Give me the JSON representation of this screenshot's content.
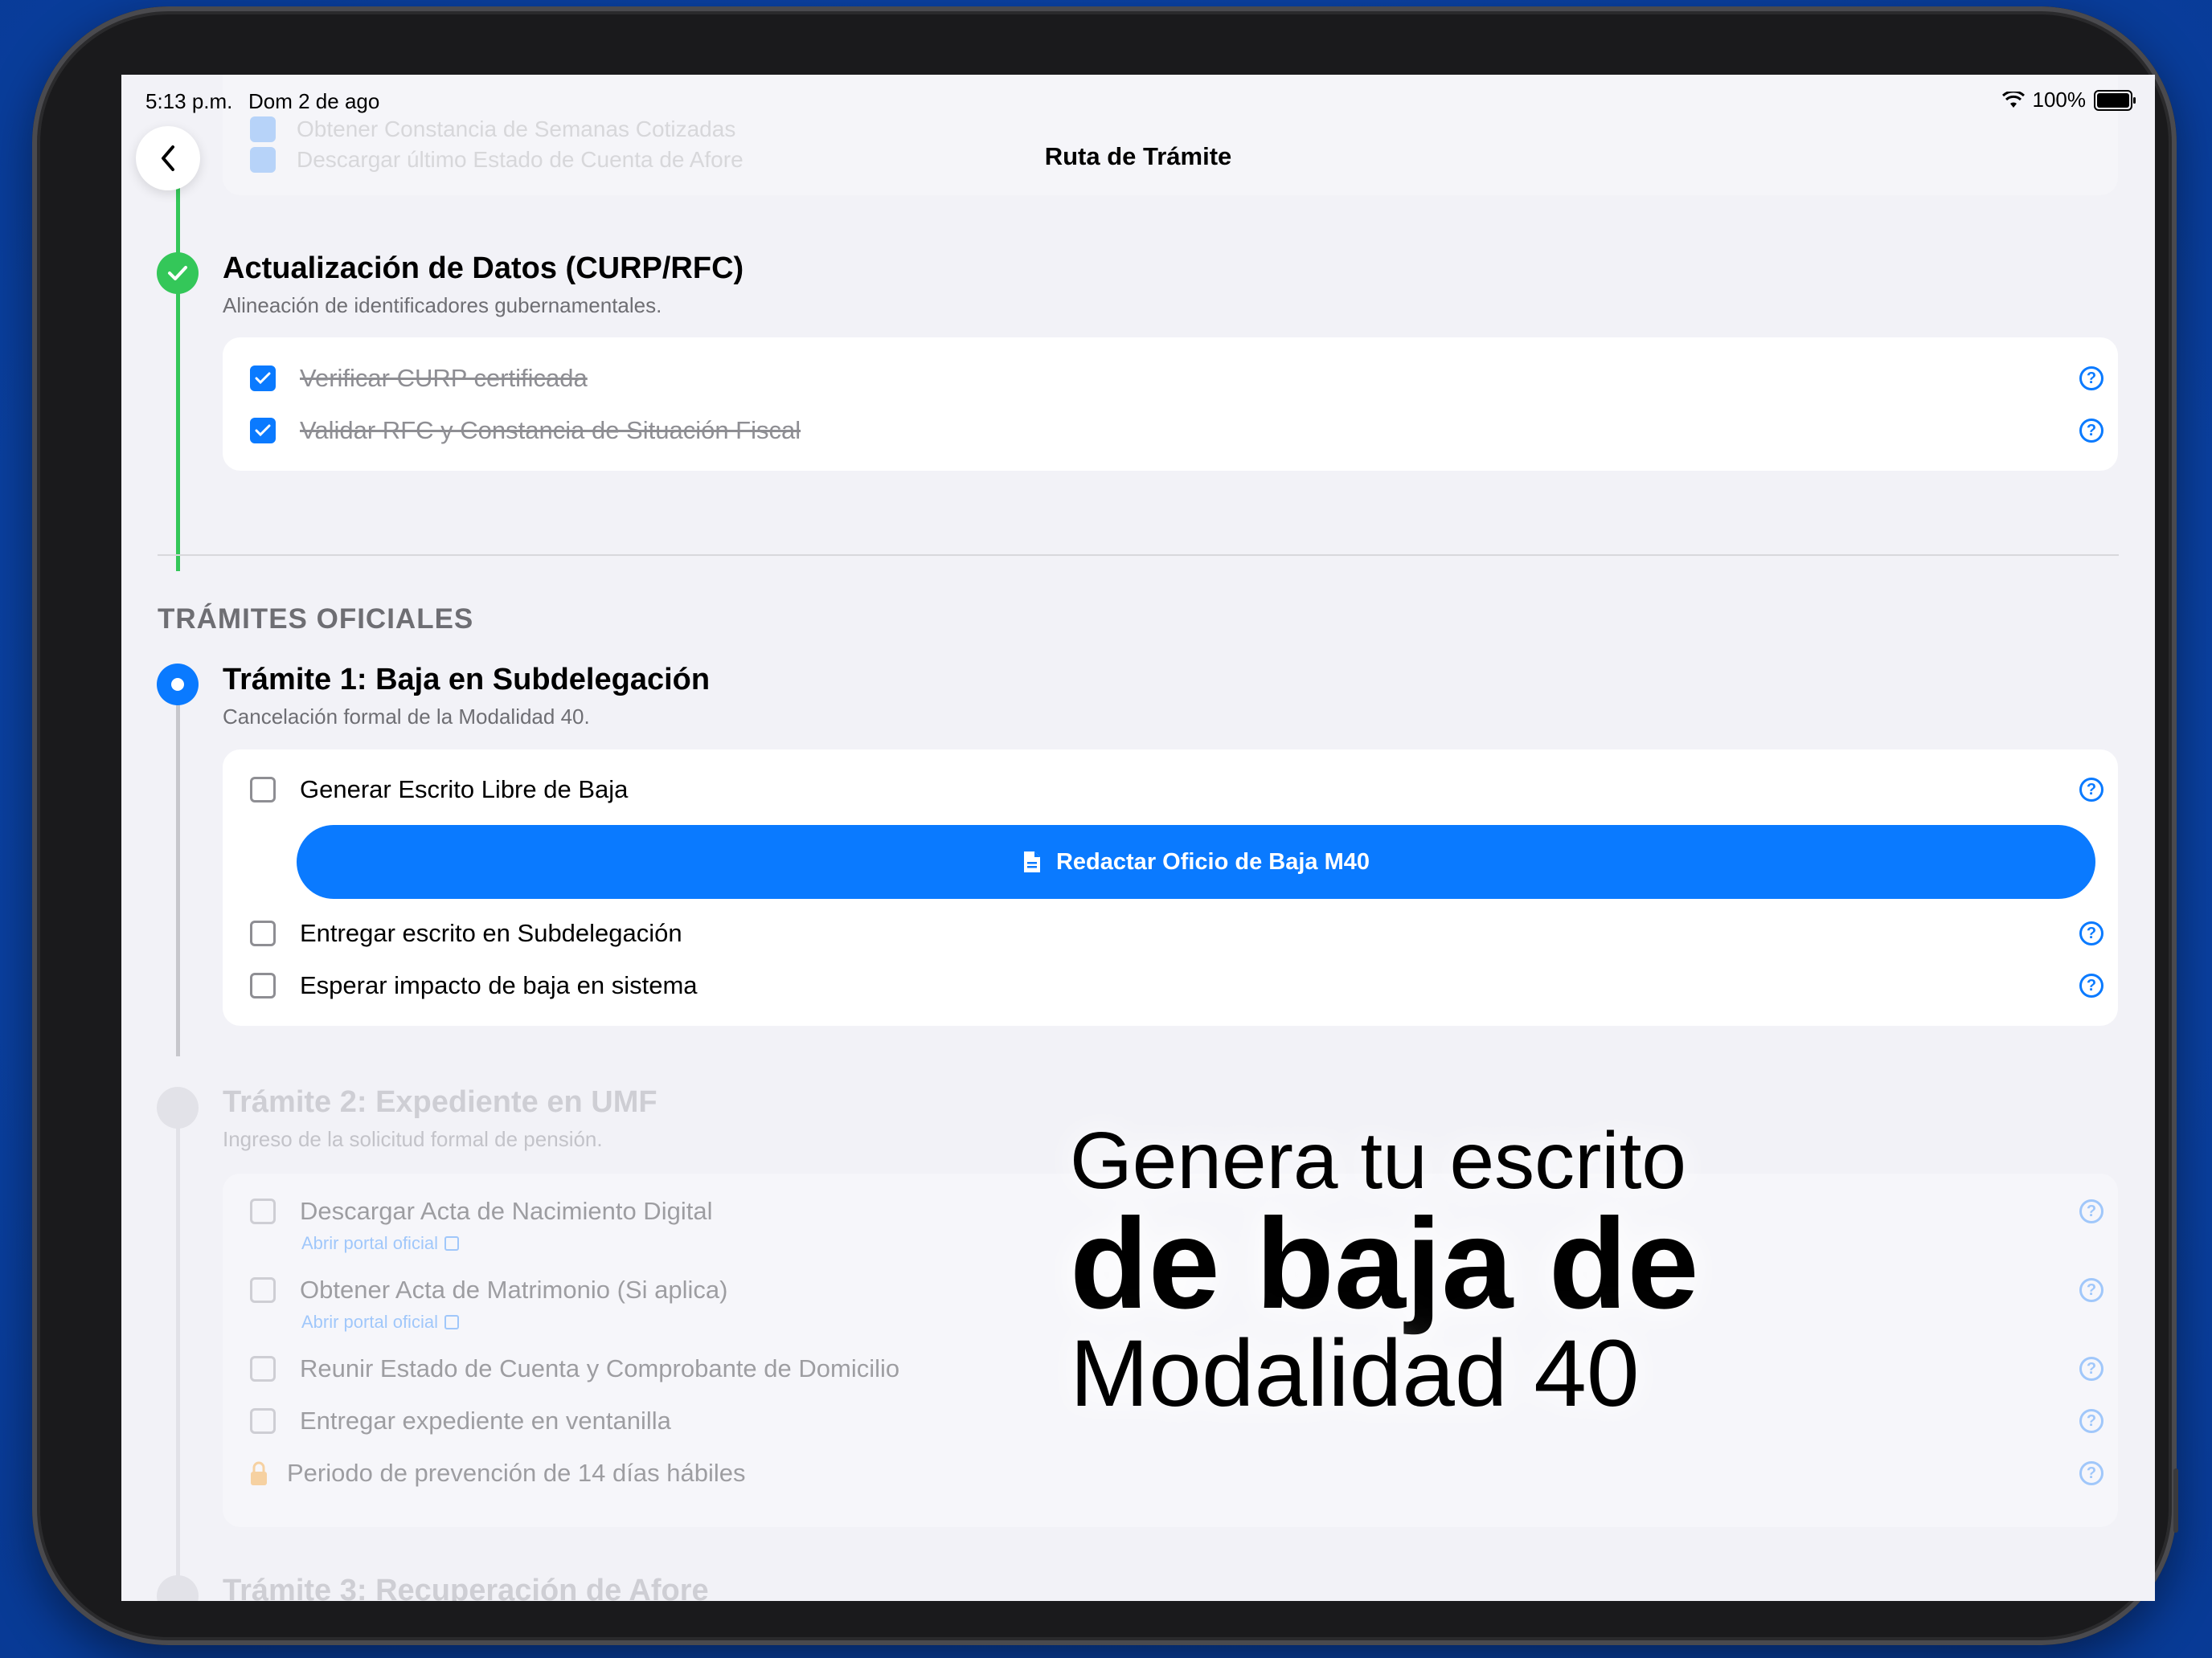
{
  "status_bar": {
    "time": "5:13 p.m.",
    "date": "Dom 2 de ago",
    "battery": "100%"
  },
  "nav": {
    "title": "Ruta de Trámite"
  },
  "top_card": {
    "items": [
      {
        "label": "Obtener Constancia de Semanas Cotizadas",
        "checked": true
      },
      {
        "label": "Descargar último Estado de Cuenta de Afore",
        "checked": true
      }
    ]
  },
  "step_datos": {
    "title": "Actualización de Datos (CURP/RFC)",
    "subtitle": "Alineación de identificadores gubernamentales.",
    "items": [
      {
        "label": "Verificar CURP certificada",
        "checked": true
      },
      {
        "label": "Validar RFC y Constancia de Situación Fiscal",
        "checked": true
      }
    ]
  },
  "section_oficiales": {
    "header": "TRÁMITES OFICIALES"
  },
  "tramite1": {
    "title": "Trámite 1: Baja en Subdelegación",
    "subtitle": "Cancelación formal de la Modalidad 40.",
    "items": [
      {
        "label": "Generar Escrito Libre de Baja",
        "checked": false
      },
      {
        "label": "Entregar escrito en Subdelegación",
        "checked": false
      },
      {
        "label": "Esperar impacto de baja en sistema",
        "checked": false
      }
    ],
    "action_button": "Redactar Oficio de Baja M40"
  },
  "tramite2": {
    "title": "Trámite 2: Expediente en UMF",
    "subtitle": "Ingreso de la solicitud formal de pensión.",
    "items": [
      {
        "label": "Descargar Acta de Nacimiento Digital",
        "link": "Abrir portal oficial"
      },
      {
        "label": "Obtener Acta de Matrimonio (Si aplica)",
        "link": "Abrir portal oficial"
      },
      {
        "label": "Reunir Estado de Cuenta y Comprobante de Domicilio"
      },
      {
        "label": "Entregar expediente en ventanilla"
      },
      {
        "label": "Periodo de prevención de 14 días hábiles",
        "locked": true
      }
    ]
  },
  "tramite3": {
    "title": "Trámite 3: Recuperación de Afore"
  },
  "promo": {
    "line1": "Genera tu escrito",
    "line2": "de baja de",
    "line3": "Modalidad 40"
  },
  "icons": {
    "help": "question-circle-icon",
    "back": "chevron-left-icon",
    "check": "checkmark-icon",
    "doc": "document-icon",
    "lock": "lock-icon",
    "external": "external-link-icon"
  },
  "colors": {
    "accent": "#0a7aff",
    "success": "#34c759",
    "background": "#0a47b0"
  }
}
